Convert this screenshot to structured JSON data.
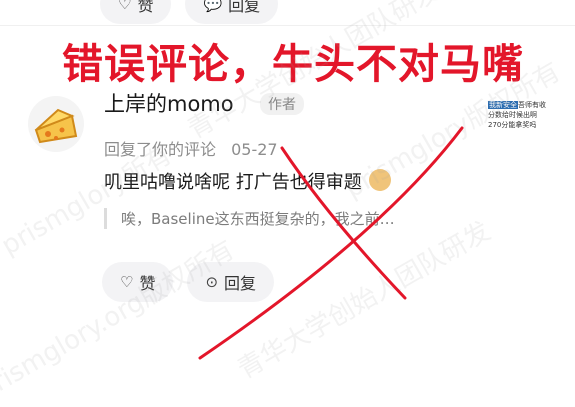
{
  "top_actions": {
    "like_label": "赞",
    "reply_label": "回复"
  },
  "headline": "错误评论，牛头不对马嘴",
  "comment": {
    "username": "上岸的momo",
    "author_badge": "作者",
    "replied_to": "回复了你的评论",
    "date": "05-27",
    "text": "叽里咕噜说啥呢 打广告也得审题",
    "quote": "唉，Baseline这东西挺复杂的，我之前…",
    "like_label": "赞",
    "reply_label": "回复"
  },
  "thumbnail": {
    "line1": "我新安全",
    "line1_rest": "吾师有收",
    "line2": "分数给时候出啊",
    "line3": "270分能拿奖吗"
  },
  "watermarks": [
    "prismglory所有",
    "青华大学创始人团队研发",
    "prismglory.org版权所有",
    "prismglory版权所有",
    "青华大学创始人团队研发"
  ],
  "colors": {
    "headline": "#e3162a",
    "cross": "#e3162a"
  }
}
